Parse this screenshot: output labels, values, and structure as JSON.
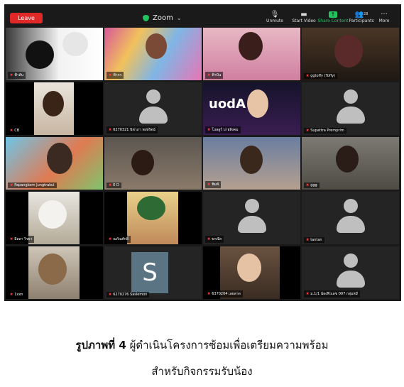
{
  "toolbar": {
    "leave_label": "Leave",
    "app_title": "Zoom",
    "unmute_label": "Unmute",
    "start_video_label": "Start Video",
    "share_content_label": "Share Content",
    "participants_label": "Participants",
    "participants_count": "28",
    "more_label": "More"
  },
  "participants": [
    {
      "name": "ฟ้าลัน"
    },
    {
      "name": "ฟ้ากร"
    },
    {
      "name": "ฟ้าปัน"
    },
    {
      "name": "ggtoffy (Toffy)"
    },
    {
      "name": "CB"
    },
    {
      "name": "6270321 นิชาภา พงษ์รัตน์"
    },
    {
      "name": "โบลลูร์ บายสิงคม"
    },
    {
      "name": "Supattra Premprim"
    },
    {
      "name": "Papangkorn Jungtrakul"
    },
    {
      "name": "E D"
    },
    {
      "name": "พิมพ์"
    },
    {
      "name": "ggg"
    },
    {
      "name": "มิลลา วิรยา"
    },
    {
      "name": "ณกัณศักดิ์"
    },
    {
      "name": "ฆาณิก"
    },
    {
      "name": "tantan"
    },
    {
      "name": "1xxn"
    },
    {
      "name": "6270276 Saslemon"
    },
    {
      "name": "6370204 เลยลาด"
    },
    {
      "name": "ม.1/1 น้องฟิวเลข 007 กลุ่มหมี"
    }
  ],
  "overlay_text": {
    "video_text": "uodA"
  },
  "caption": {
    "label": "รูปภาพที่ 4",
    "line1": "ผู้ดำเนินโครงการซ้อมเพื่อเตรียมความพร้อม",
    "line2": "สำหรับกิจกรรมรับน้อง"
  },
  "colors": {
    "leave": "#e02828",
    "share": "#23c45e",
    "active_speaker": "#6ee05c",
    "avatar": "#bfbfbf"
  }
}
